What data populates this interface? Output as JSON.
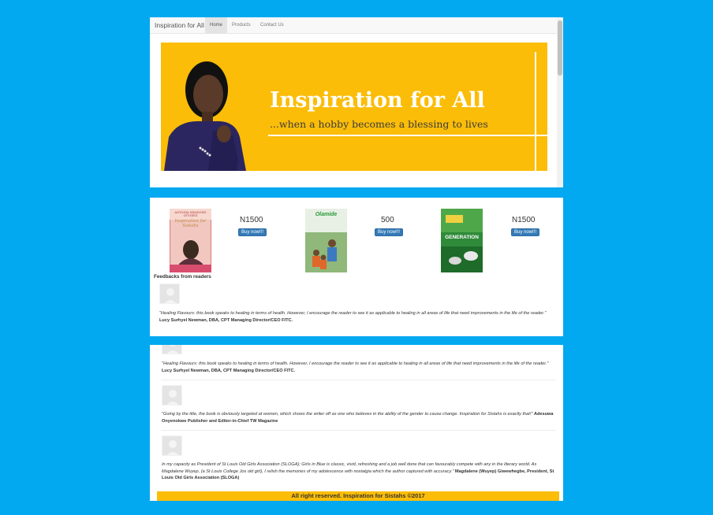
{
  "navbar": {
    "brand": "Inspiration for All",
    "items": [
      {
        "label": "Home",
        "active": true
      },
      {
        "label": "Products",
        "active": false
      },
      {
        "label": "Contact Us",
        "active": false
      }
    ]
  },
  "banner": {
    "title": "Inspiration for All",
    "subtitle": "...when a hobby becomes a blessing to lives"
  },
  "products": [
    {
      "price": "N1500",
      "button": "Buy now!!!",
      "cover_title": "Inspiration for Sistahs",
      "cover_author": "ANTONIA MEADOWS OTVNEVI"
    },
    {
      "price": "500",
      "button": "Buy now!!!",
      "cover_title": "Olamide",
      "cover_author": ""
    },
    {
      "price": "N1500",
      "button": "Buy now!!!",
      "cover_title": "GENERATION",
      "cover_author": ""
    }
  ],
  "feedback": {
    "heading": "Feedbacks from readers",
    "items": [
      {
        "quote": "\"Healing Flavours: this book speaks to healing in terms of health. However, I encourage the reader to see it as applicable to healing in all areas of life that need improvements in the life of the reader.\"",
        "author": "Lucy Surhyel Newman, DBA, CPT Managing Director/CEO FITC."
      },
      {
        "quote": "\"Going by the title, the book is obviously targeted at women, which shows the writer off as one who believes in the ability of the gender to cause change. Inspiration for Sistahs is exactly that!\"",
        "author": "Adesuwa Onyenokwe Publisher and Editor-in-Chief TW Magazine"
      },
      {
        "quote": "In my capacity as President of St Louis Old Girls Association (SLOGA); Girls in Blue is classic, vivid, refreshing and a job well done that can favourably compete with any in the literary world. As Magdalene Wuyep, (a St Louis College Jos old girl), I relish the memories of my adolescence with nostalgia which the author captured with accuracy.\"",
        "author": "Magdalene (Wuyep) Giwewhegbe, President, St Louis Old Girls Association (SLOGA)"
      }
    ]
  },
  "footer": {
    "text": "All right reserved. Inspiration for Sistahs ©2017"
  },
  "colors": {
    "page_bg": "#03a9f0",
    "banner_yellow": "#fbbd08",
    "button_blue": "#337ab7"
  }
}
